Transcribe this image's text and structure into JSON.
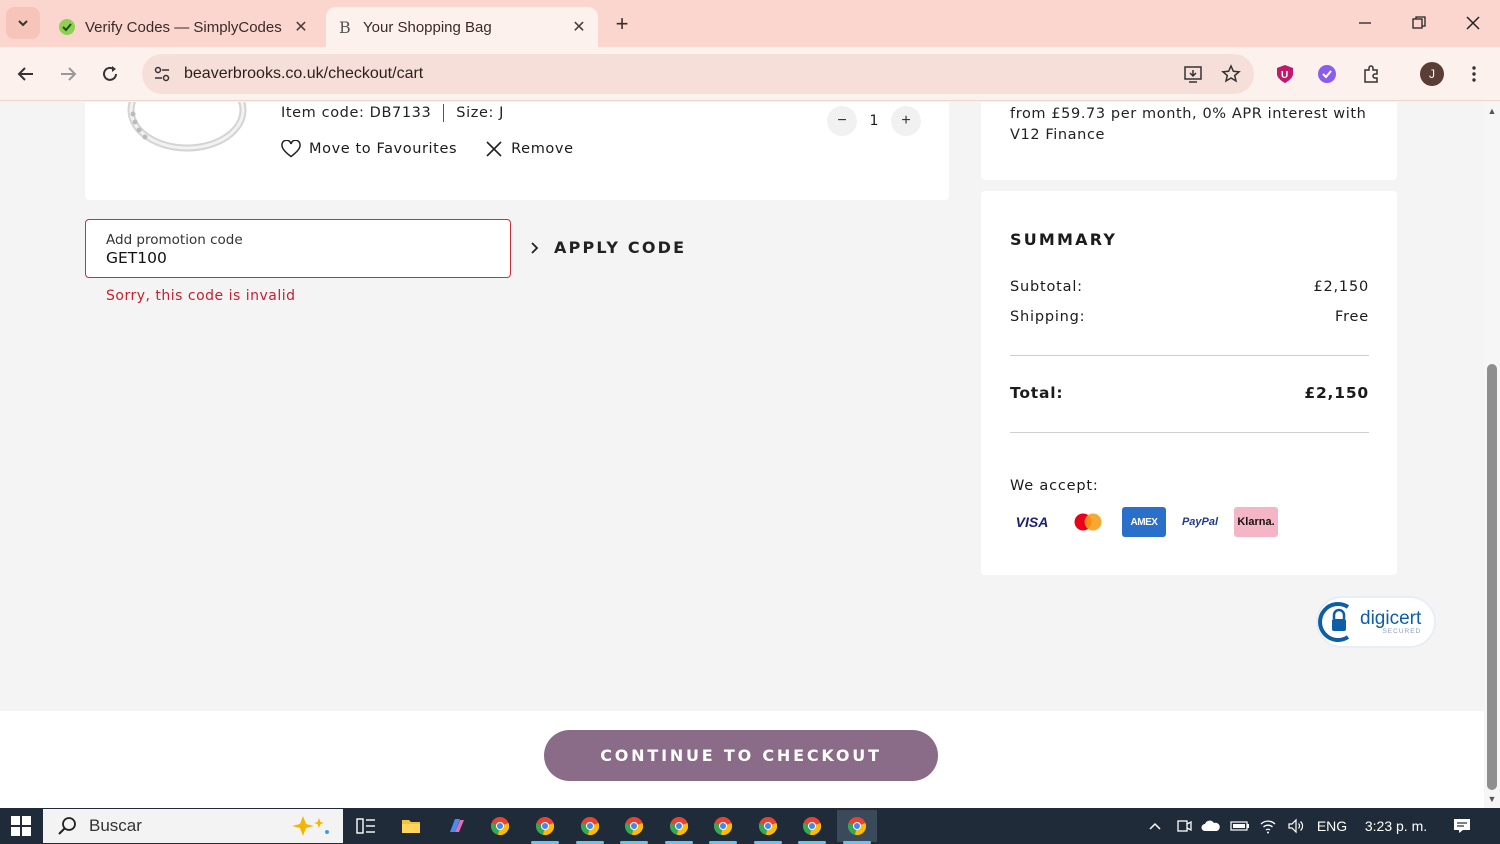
{
  "browser": {
    "tabs": [
      {
        "title": "Verify Codes — SimplyCodes",
        "active": false
      },
      {
        "title": "Your Shopping Bag",
        "active": true
      }
    ],
    "url": "beaverbrooks.co.uk/checkout/cart",
    "profile_initial": "J"
  },
  "cart_item": {
    "item_code_label": "Item code: DB7133",
    "size_label": "Size: J",
    "quantity": "1",
    "move_to_favourites": "Move to Favourites",
    "remove": "Remove"
  },
  "promo": {
    "label": "Add promotion code",
    "value": "GET100",
    "apply_label": "APPLY CODE",
    "error": "Sorry, this code is invalid"
  },
  "finance": {
    "text": "from £59.73 per month, 0% APR interest with V12 Finance"
  },
  "summary": {
    "title": "SUMMARY",
    "subtotal_label": "Subtotal:",
    "subtotal_value": "£2,150",
    "shipping_label": "Shipping:",
    "shipping_value": "Free",
    "total_label": "Total:",
    "total_value": "£2,150",
    "we_accept": "We accept:",
    "payment_methods": [
      "VISA",
      "Mastercard",
      "AMEX",
      "PayPal",
      "Klarna."
    ]
  },
  "badge": {
    "brand": "digicert",
    "sub": "SECURED"
  },
  "checkout_button": "CONTINUE TO CHECKOUT",
  "taskbar": {
    "search_placeholder": "Buscar",
    "language": "ENG",
    "time": "3:23 p. m."
  },
  "colors": {
    "tab_bar": "#fbd6cf",
    "error_red": "#c4212f",
    "checkout_button": "#8b6c88",
    "taskbar": "#1f2b38"
  }
}
